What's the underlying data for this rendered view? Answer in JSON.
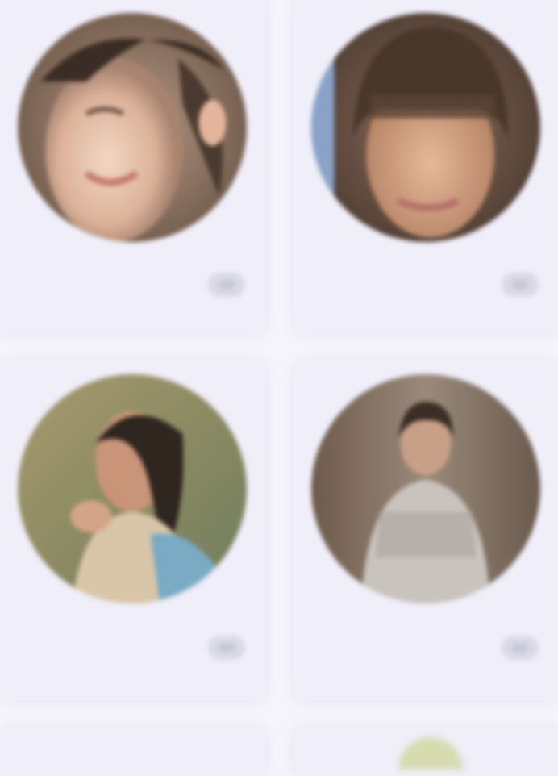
{
  "profiles": [
    {
      "name": "",
      "subtitle": "",
      "action_icon": "more-icon"
    },
    {
      "name": "",
      "subtitle": "",
      "action_icon": "more-icon"
    },
    {
      "name": "",
      "subtitle": "",
      "action_icon": "more-icon"
    },
    {
      "name": "",
      "subtitle": "",
      "action_icon": "more-icon"
    }
  ],
  "colors": {
    "page_background": "#f6f5fc",
    "card_background": "#efeef9",
    "placeholder_text": "#c9c8d8"
  }
}
